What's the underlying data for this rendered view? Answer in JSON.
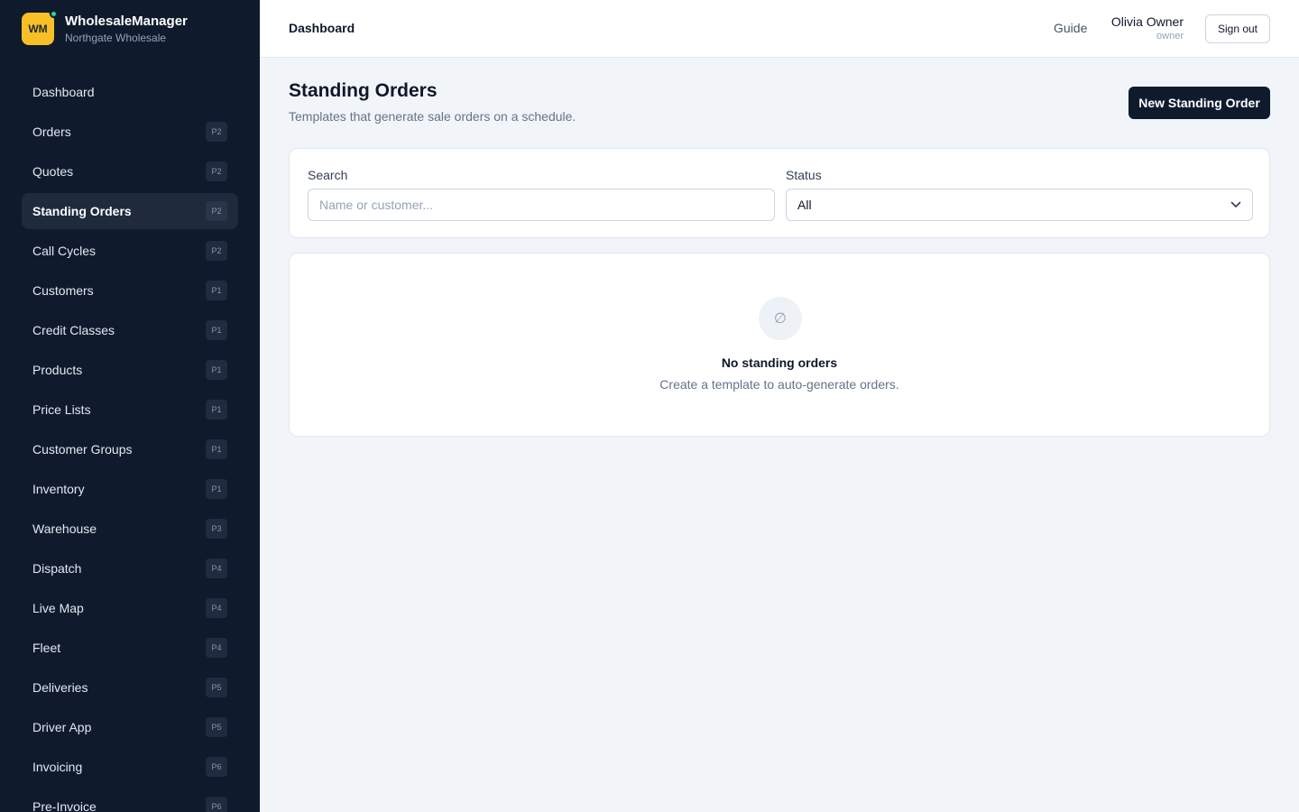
{
  "brand": {
    "logo_text": "WM",
    "name": "WholesaleManager",
    "subtitle": "Northgate Wholesale"
  },
  "sidebar": {
    "items": [
      {
        "label": "Dashboard",
        "badge": ""
      },
      {
        "label": "Orders",
        "badge": "P2"
      },
      {
        "label": "Quotes",
        "badge": "P2"
      },
      {
        "label": "Standing Orders",
        "badge": "P2",
        "active": true
      },
      {
        "label": "Call Cycles",
        "badge": "P2"
      },
      {
        "label": "Customers",
        "badge": "P1"
      },
      {
        "label": "Credit Classes",
        "badge": "P1"
      },
      {
        "label": "Products",
        "badge": "P1"
      },
      {
        "label": "Price Lists",
        "badge": "P1"
      },
      {
        "label": "Customer Groups",
        "badge": "P1"
      },
      {
        "label": "Inventory",
        "badge": "P1"
      },
      {
        "label": "Warehouse",
        "badge": "P3"
      },
      {
        "label": "Dispatch",
        "badge": "P4"
      },
      {
        "label": "Live Map",
        "badge": "P4"
      },
      {
        "label": "Fleet",
        "badge": "P4"
      },
      {
        "label": "Deliveries",
        "badge": "P5"
      },
      {
        "label": "Driver App",
        "badge": "P5"
      },
      {
        "label": "Invoicing",
        "badge": "P6"
      },
      {
        "label": "Pre-Invoice",
        "badge": "P6"
      }
    ]
  },
  "header": {
    "title": "Dashboard",
    "guide_label": "Guide",
    "user_name": "Olivia Owner",
    "user_role": "owner",
    "signout_label": "Sign out"
  },
  "main": {
    "title": "Standing Orders",
    "subtitle": "Templates that generate sale orders on a schedule.",
    "new_button_label": "New Standing Order",
    "filters": {
      "search_label": "Search",
      "search_placeholder": "Name or customer...",
      "search_value": "",
      "status_label": "Status",
      "status_value": "All"
    },
    "empty": {
      "icon_glyph": "∅",
      "title": "No standing orders",
      "text": "Create a template to auto-generate orders."
    }
  },
  "colors": {
    "sidebar_bg": "#0f1b2d",
    "brand_accent": "#f6c026",
    "status_dot": "#2dd4a7",
    "primary_button": "#0f1b2d",
    "page_bg": "#f1f4f8"
  }
}
